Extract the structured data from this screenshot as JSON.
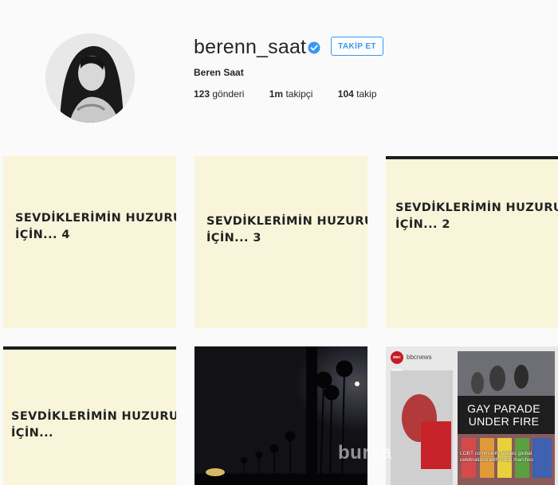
{
  "profile": {
    "username": "berenn_saat",
    "verified": true,
    "follow_label": "TAKİP ET",
    "full_name": "Beren Saat",
    "stats": [
      {
        "count": "123",
        "label": "gönderi"
      },
      {
        "count": "1m",
        "label": "takipçi"
      },
      {
        "count": "104",
        "label": "takip"
      }
    ]
  },
  "posts": [
    {
      "caption_line1": "SEVDİKLERİMİN HUZURU",
      "caption_line2": "İÇİN... 4"
    },
    {
      "caption_line1": "SEVDİKLERİMİN HUZURU",
      "caption_line2": "İÇİN... 3"
    },
    {
      "caption_line1": "SEVDİKLERİMİN HUZURU",
      "caption_line2": "İÇİN... 2"
    },
    {
      "caption_line1": "SEVDİKLERİMİN HUZURU",
      "caption_line2": "İÇİN..."
    },
    {
      "caption_line1": "",
      "caption_line2": ""
    },
    {
      "source": "bbcnews",
      "logo_text": "BBC NEWS",
      "headline_line1": "GAY PARADE",
      "headline_line2": "UNDER FIRE",
      "subhead": "LGBT community stages global celebrations with Pride marches"
    }
  ],
  "watermark": "bursa",
  "colors": {
    "accent": "#3897f0",
    "tile_bg": "#f8f5da"
  },
  "icons": {
    "verified": "verified-badge-icon"
  }
}
